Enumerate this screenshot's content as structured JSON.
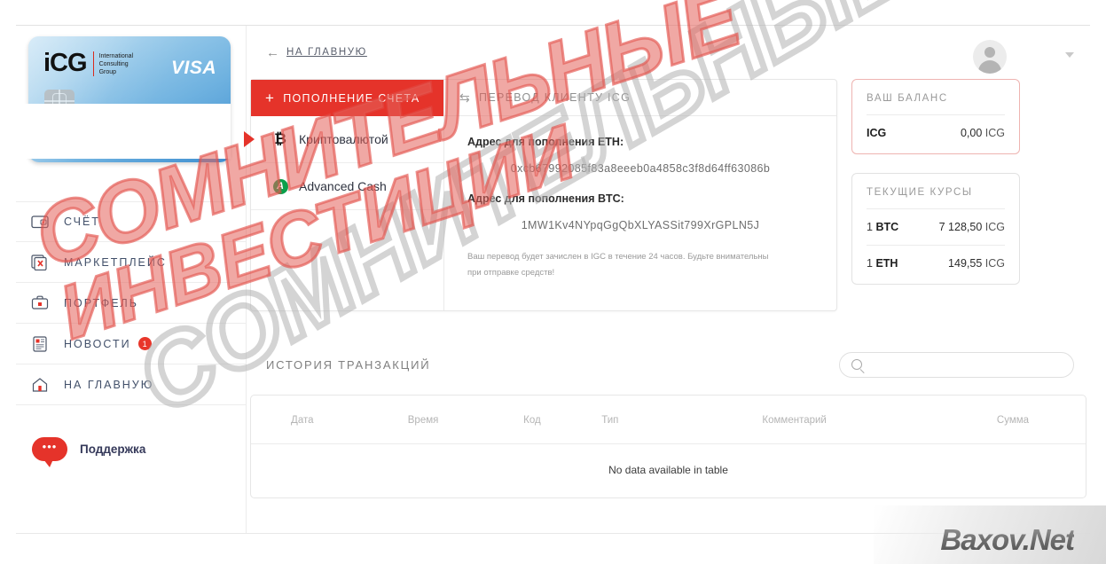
{
  "sidebar": {
    "card": {
      "brand": "iCG",
      "brand_sub_line1": "International",
      "brand_sub_line2": "Consulting",
      "brand_sub_line3": "Group",
      "network": "VISA"
    },
    "items": [
      {
        "label": "СЧЁТ",
        "icon": "wallet-icon",
        "badge": null
      },
      {
        "label": "МАРКЕТПЛЕЙС",
        "icon": "marketplace-icon",
        "badge": null
      },
      {
        "label": "ПОРТФЕЛЬ",
        "icon": "briefcase-icon",
        "badge": null
      },
      {
        "label": "НОВОСТИ",
        "icon": "news-icon",
        "badge": "1"
      },
      {
        "label": "НА ГЛАВНУЮ",
        "icon": "home-icon",
        "badge": null
      }
    ],
    "support": {
      "label": "Поддержка",
      "icon": "chat-bubble-icon",
      "dots": "•••"
    }
  },
  "topbar": {
    "back_label": "НА ГЛАВНУЮ",
    "back_arrow": "←",
    "caret": "▼"
  },
  "deposit": {
    "tab_primary": {
      "label": "ПОПОЛНЕНИЕ СЧЕТА",
      "plus": "+"
    },
    "tab_secondary": {
      "label": "ПЕРЕВОД КЛИЕНТУ ICG",
      "swap": "⇆"
    },
    "methods": [
      {
        "label": "Криптовалютой",
        "icon": "bitcoin-icon",
        "glyph": "₿",
        "active": true
      },
      {
        "label": "Advanced Cash",
        "icon": "advcash-icon",
        "glyph": "A",
        "active": false
      }
    ],
    "eth_label": "Адрес для пополнения ETH:",
    "eth_address": "0xcb67992085f83a8eeeb0a4858c3f8d64ff63086b",
    "btc_label": "Адрес для пополнения BTC:",
    "btc_address": "1MW1Kv4NYpqGgQbXLYASSit799XrGPLN5J",
    "note_line1": "Ваш перевод будет зачислен в IGC в течение 24 часов. Будьте внимательны",
    "note_line2": "при отправке средств!"
  },
  "balance": {
    "title": "ВАШ БАЛАНС",
    "currency": "ICG",
    "amount": "0,00",
    "unit": "ICG"
  },
  "rates": {
    "title": "ТЕКУЩИЕ КУРСЫ",
    "rows": [
      {
        "pre": "1",
        "code": "BTC",
        "value": "7 128,50",
        "unit": "ICG"
      },
      {
        "pre": "1",
        "code": "ETH",
        "value": "149,55",
        "unit": "ICG"
      }
    ]
  },
  "history": {
    "title": "ИСТОРИЯ ТРАНЗАКЦИЙ",
    "search_placeholder": "",
    "search_value": "",
    "columns": [
      "Дата",
      "Время",
      "Код",
      "Тип",
      "Комментарий",
      "Сумма"
    ],
    "empty_message": "No data available in table"
  },
  "watermarks": {
    "main_line1": "СОМНИТЕЛЬНЫЕ",
    "main_line2": "ИНВЕСТИЦИИ",
    "site": "Baxov.Net"
  },
  "colors": {
    "accent_red": "#e5332a",
    "nav_text": "#42506a",
    "muted": "#9a9a9a",
    "card_blue": "#6fb2e0"
  }
}
